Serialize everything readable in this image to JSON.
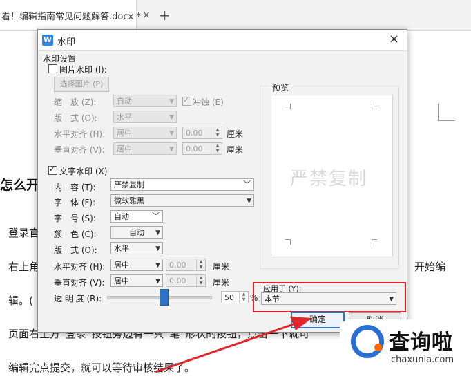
{
  "document": {
    "tab_title": "看！编辑指南常见问题解答.docx *",
    "tab_close": "×",
    "tab_add": "+",
    "heading": "怎么开",
    "lines": [
      "登录官",
      "右上角",
      "开始编",
      "辑。(",
      "页面右上方“登录”按钮旁边有一只“笔”形状的按钮，点击一下就可",
      "编辑完点提交，就可以等待审核结果了。"
    ]
  },
  "dialog": {
    "title": "水印",
    "app_icon_letter": "W",
    "close": "×",
    "group_title": "水印设置",
    "picture": {
      "checkbox_label": "图片水印 (I):",
      "checked": false,
      "select_image_button": "选择图片 (P)",
      "scale_label": "缩　放 (Z):",
      "scale_value": "自动",
      "washout_label": "冲蚀 (E)",
      "washout_checked": true,
      "layout_label": "版　式 (O):",
      "layout_value": "水平",
      "halign_label": "水平对齐 (H):",
      "halign_value": "居中",
      "halign_offset": "0.00",
      "valign_label": "垂直对齐 (V):",
      "valign_value": "居中",
      "valign_offset": "0.00",
      "unit": "厘米"
    },
    "text": {
      "checkbox_label": "文字水印 (X)",
      "checked": true,
      "content_label": "内　容 (T):",
      "content_value": "严禁复制",
      "font_label": "字　体 (F):",
      "font_value": "微软雅黑",
      "size_label": "字　号 (S):",
      "size_value": "自动",
      "color_label": "颜　色 (C):",
      "color_value": "自动",
      "layout_label": "版　式 (O):",
      "layout_value": "水平",
      "halign_label": "水平对齐 (H):",
      "halign_value": "居中",
      "halign_offset": "0.00",
      "valign_label": "垂直对齐 (V):",
      "valign_value": "居中",
      "valign_offset": "0.00",
      "unit": "厘米",
      "transparency_label": "透 明 度 (R):",
      "transparency_value": "50",
      "transparency_fraction": 0.5,
      "percent_sign": "%"
    },
    "preview": {
      "label": "预览",
      "watermark_text": "严禁复制"
    },
    "apply": {
      "label": "应用于 (Y):",
      "value": "本节"
    },
    "buttons": {
      "ok": "确定",
      "cancel": "取消"
    }
  },
  "watermark_logo": {
    "name": "查询啦",
    "url": "chaxunla.com"
  },
  "colors": {
    "highlight_red": "#e0262b",
    "accent_blue": "#2d74d0",
    "logo_blue": "#2b6fd6",
    "logo_orange": "#ff6a00"
  }
}
